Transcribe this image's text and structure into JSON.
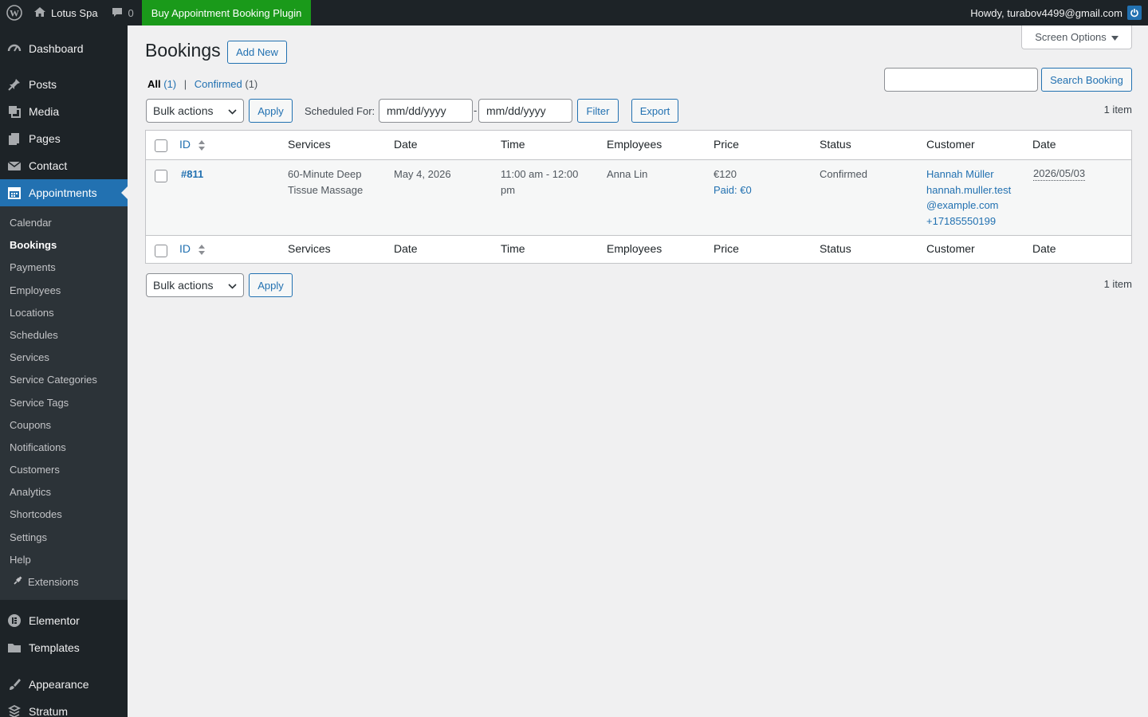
{
  "adminbar": {
    "site_name": "Lotus Spa",
    "comments_count": "0",
    "buy_label": "Buy Appointment Booking Plugin",
    "howdy": "Howdy, turabov4499@gmail.com"
  },
  "sidebar": {
    "dashboard": "Dashboard",
    "posts": "Posts",
    "media": "Media",
    "pages": "Pages",
    "contact": "Contact",
    "appointments": "Appointments",
    "submenu": [
      "Calendar",
      "Bookings",
      "Payments",
      "Employees",
      "Locations",
      "Schedules",
      "Services",
      "Service Categories",
      "Service Tags",
      "Coupons",
      "Notifications",
      "Customers",
      "Analytics",
      "Shortcodes",
      "Settings",
      "Help",
      "Extensions"
    ],
    "elementor": "Elementor",
    "templates": "Templates",
    "appearance": "Appearance",
    "stratum": "Stratum"
  },
  "page": {
    "title": "Bookings",
    "add_new": "Add New",
    "screen_options": "Screen Options",
    "filter_all": "All",
    "filter_all_count": "(1)",
    "filter_sep": "|",
    "filter_confirmed": "Confirmed",
    "filter_confirmed_count": "(1)",
    "search_button": "Search Booking",
    "search_value": "",
    "bulk_actions": "Bulk actions",
    "apply": "Apply",
    "scheduled_for": "Scheduled For:",
    "date_from_placeholder": "mm/dd/yyyy",
    "date_dash": "-",
    "date_to_placeholder": "mm/dd/yyyy",
    "filter_button": "Filter",
    "export_button": "Export",
    "items_count": "1 item"
  },
  "table": {
    "columns": [
      "ID",
      "Services",
      "Date",
      "Time",
      "Employees",
      "Price",
      "Status",
      "Customer",
      "Date"
    ],
    "row": {
      "id": "#811",
      "service_line1": "60-Minute Deep",
      "service_line2": "Tissue Massage",
      "date": "May 4, 2026",
      "time_line1": "11:00 am - 12:00",
      "time_line2": "pm",
      "employee": "Anna Lin",
      "price": "€120",
      "paid": "Paid: €0",
      "status": "Confirmed",
      "customer_name": "Hannah Müller",
      "customer_email_line1": "hannah.muller.test",
      "customer_email_line2": "@example.com",
      "customer_phone": "+17185550199",
      "created": "2026/05/03"
    }
  },
  "colors": {
    "accent": "#2271b1",
    "adminbar_bg": "#1d2327",
    "buy_bg": "#1a9a1a"
  }
}
